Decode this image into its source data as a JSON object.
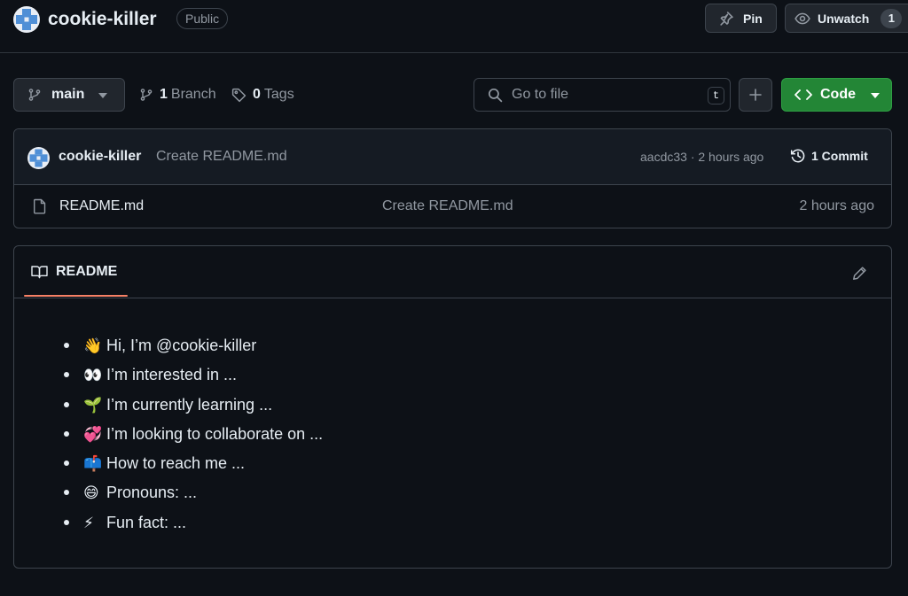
{
  "repo": {
    "name": "cookie-killer",
    "visibility": "Public"
  },
  "header_actions": {
    "pin_label": "Pin",
    "watch_label": "Unwatch",
    "watch_count": "1"
  },
  "file_nav": {
    "branch": "main",
    "branch_count": "1",
    "branch_word": "Branch",
    "tag_count": "0",
    "tag_word": "Tags",
    "goto_placeholder": "Go to file",
    "goto_shortcut": "t",
    "code_label": "Code"
  },
  "latest_commit": {
    "author": "cookie-killer",
    "message": "Create README.md",
    "meta": "aacdc33 · 2 hours ago",
    "commits_label": "1 Commit"
  },
  "files": [
    {
      "name": "README.md",
      "commit_message": "Create README.md",
      "age": "2 hours ago"
    }
  ],
  "readme": {
    "tab_label": "README",
    "items": [
      {
        "emoji": "👋",
        "text": "Hi, I’m @cookie-killer"
      },
      {
        "emoji": "👀",
        "text": "I’m interested in ..."
      },
      {
        "emoji": "🌱",
        "text": "I’m currently learning ..."
      },
      {
        "emoji": "💞️",
        "text": "I’m looking to collaborate on ..."
      },
      {
        "emoji": "📫",
        "text": "How to reach me ..."
      },
      {
        "emoji": "😄",
        "text": "Pronouns: ..."
      },
      {
        "emoji": "⚡",
        "text": "Fun fact: ..."
      }
    ]
  },
  "colors": {
    "background": "#0d1117",
    "border": "#3d444d",
    "accent_green": "#238636",
    "tab_underline": "#f78166",
    "muted_text": "#9198a1"
  },
  "icons": {
    "avatar": "identicon-avatar",
    "pin": "pin-icon",
    "watch": "eye-icon",
    "branch": "git-branch-icon",
    "tag": "tag-icon",
    "search": "search-icon",
    "add": "plus-icon",
    "code": "code-icon",
    "history": "history-icon",
    "file": "file-icon",
    "book": "book-icon",
    "edit": "pencil-icon"
  }
}
